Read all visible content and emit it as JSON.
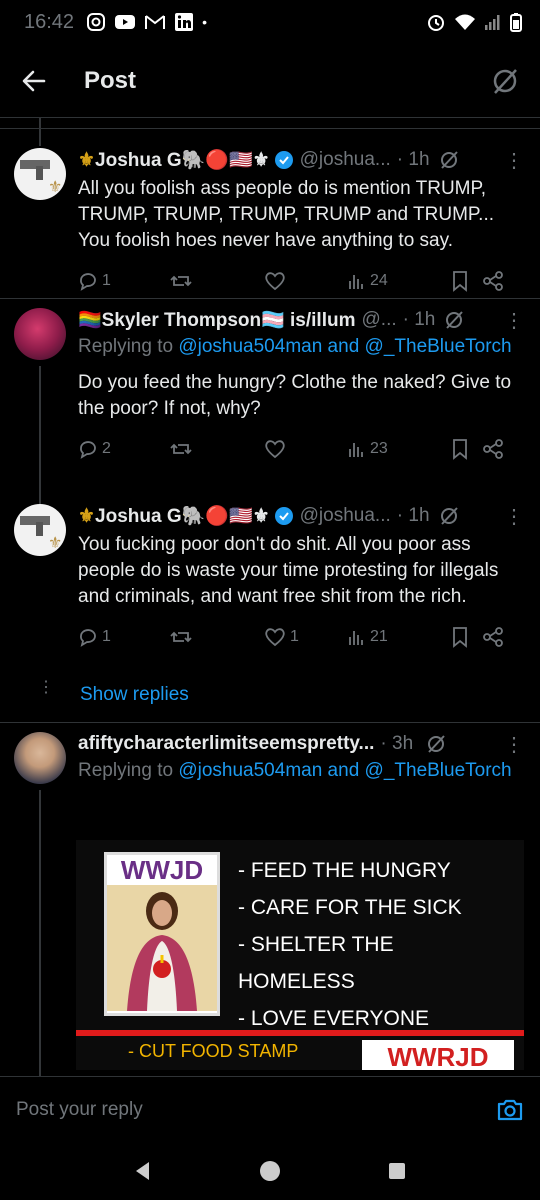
{
  "status_bar": {
    "time": "16:42"
  },
  "header": {
    "title": "Post"
  },
  "tweets": [
    {
      "name": "Joshua G",
      "name_prefix": "⚜",
      "name_suffix": "🐘🔴🇺🇸⚜",
      "handle": "@joshua...",
      "time": "· 1h",
      "text": "All you foolish ass people do is mention TRUMP, TRUMP, TRUMP, TRUMP, TRUMP and TRUMP... You foolish hoes never have anything to say.",
      "replies": "1",
      "reposts": "",
      "likes": "",
      "views": "24"
    },
    {
      "name": "Skyler Thompson",
      "name_prefix": "🏳️‍🌈",
      "name_suffix": "🏳️‍⚧️ is/illum",
      "handle": "@...",
      "time": "· 1h",
      "reply_prefix": "Replying to ",
      "reply_users": "@joshua504man and @_TheBlueTorch",
      "text": "Do you feed the hungry? Clothe the naked? Give to the poor? If not, why?",
      "replies": "2",
      "reposts": "",
      "likes": "",
      "views": "23"
    },
    {
      "name": "Joshua G",
      "name_prefix": "⚜",
      "name_suffix": "🐘🔴🇺🇸⚜",
      "handle": "@joshua...",
      "time": "· 1h",
      "text": "You fucking poor don't do shit. All you poor ass people do is waste your time protesting for illegals and criminals, and want free shit from the rich.",
      "replies": "1",
      "reposts": "",
      "likes": "1",
      "views": "21"
    },
    {
      "name": "afiftycharacterlimitseemspretty...",
      "handle": "",
      "time": "· 3h",
      "reply_prefix": "Replying to ",
      "reply_users": "@joshua504man and @_TheBlueTorch"
    }
  ],
  "show_replies": "Show replies",
  "meme": {
    "wwjd": "WWJD",
    "lines": [
      "- FEED THE HUNGRY",
      "- CARE FOR THE SICK",
      "- SHELTER THE",
      "HOMELESS",
      "- LOVE EVERYONE"
    ],
    "bottom_left": "- CUT FOOD STAMP",
    "bottom_right": "WWRJD"
  },
  "reply_bar": {
    "placeholder": "Post your reply"
  },
  "colors": {
    "accent": "#1d9bf0",
    "muted": "#71767b",
    "background": "#000000",
    "verified": "#1d9bf0",
    "meme_red": "#e01b1b"
  }
}
